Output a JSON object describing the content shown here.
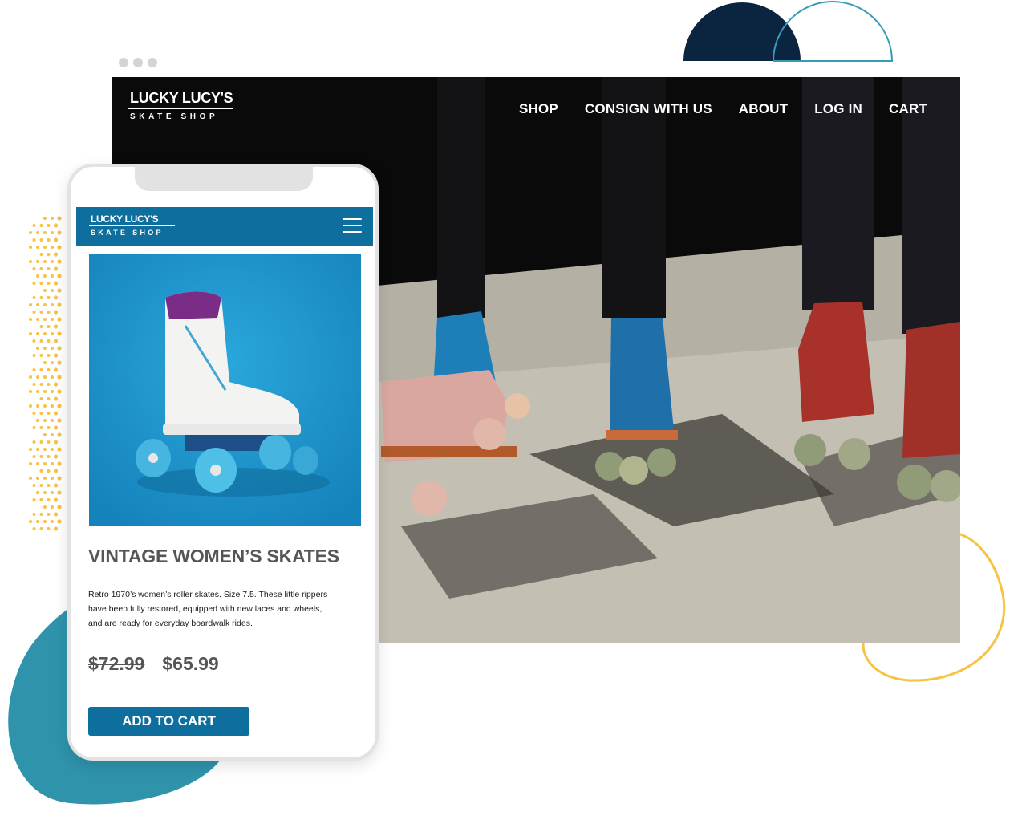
{
  "desktop": {
    "brand": {
      "name": "LUCKY LUCY'S",
      "tagline": "SKATE SHOP"
    },
    "nav": [
      "SHOP",
      "CONSIGN WITH US",
      "ABOUT",
      "LOG IN",
      "CART"
    ],
    "hero_image": "roller-skates-photo"
  },
  "mobile": {
    "brand": {
      "name": "LUCKY LUCY'S",
      "tagline": "SKATE SHOP"
    },
    "menu_icon": "hamburger-menu-icon",
    "product": {
      "image": "white-roller-skate-photo",
      "title": "VINTAGE WOMEN’S SKATES",
      "description": "Retro 1970’s women’s roller skates. Size 7.5. These little rippers have been fully restored, equipped with new laces and wheels, and are ready for everyday boardwalk rides.",
      "original_price": "$72.99",
      "sale_price": "$65.99",
      "cta": "ADD TO CART"
    }
  },
  "colors": {
    "brand_blue": "#0e6f9f",
    "dark_navy": "#0b2440",
    "teal_outline": "#3a9bb6",
    "teal_blob": "#2e93ab",
    "yellow_accent": "#f6c343",
    "text_gray": "#555555"
  }
}
